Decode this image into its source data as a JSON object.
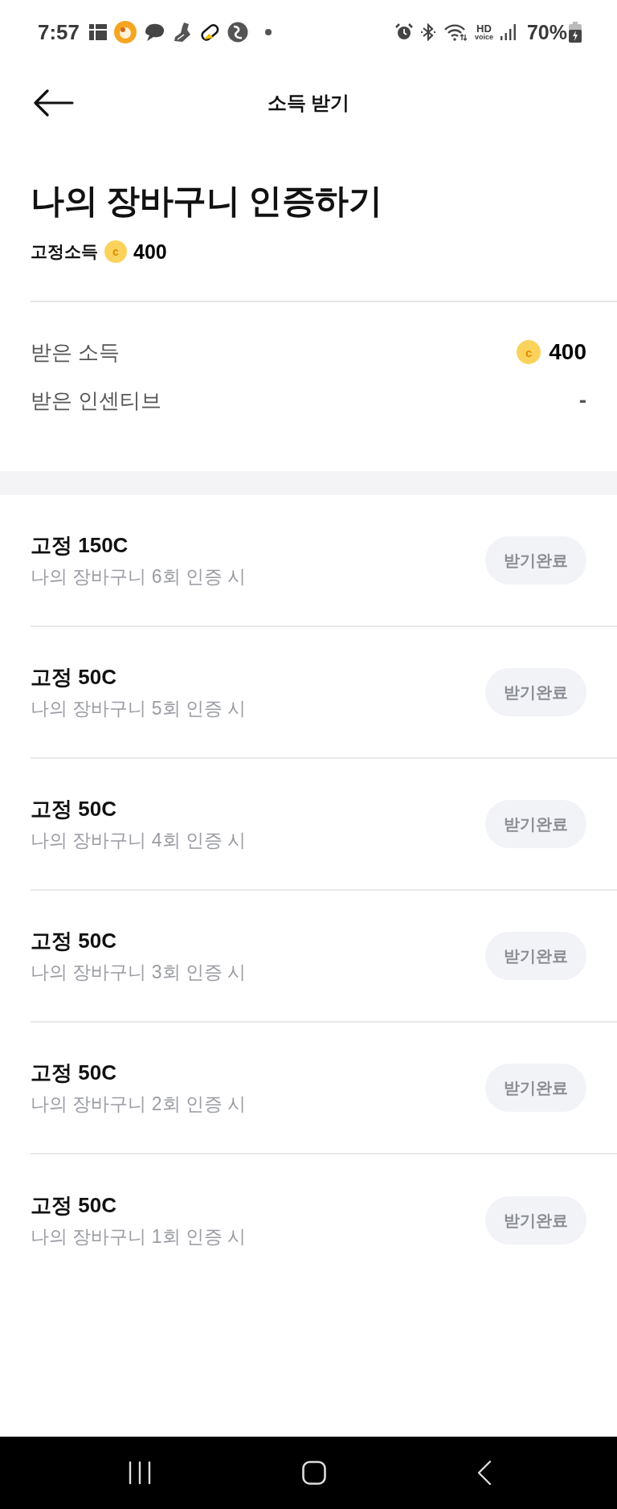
{
  "status_bar": {
    "time": "7:57",
    "hd_top": "HD",
    "hd_bottom": "voice",
    "battery": "70%"
  },
  "header": {
    "title": "소득 받기"
  },
  "mission": {
    "title": "나의 장바구니 인증하기",
    "fixed_label": "고정소득",
    "coin_mark": "c",
    "fixed_amount": "400"
  },
  "summary": [
    {
      "kind": "coin",
      "label": "받은 소득",
      "coin_mark": "c",
      "value": "400"
    },
    {
      "kind": "plain",
      "label": "받은 인센티브",
      "value": "-"
    }
  ],
  "rewards": [
    {
      "title": "고정 150C",
      "condition": "나의 장바구니 6회 인증 시",
      "button": "받기완료",
      "disabled": true
    },
    {
      "title": "고정 50C",
      "condition": "나의 장바구니 5회 인증 시",
      "button": "받기완료",
      "disabled": true
    },
    {
      "title": "고정 50C",
      "condition": "나의 장바구니 4회 인증 시",
      "button": "받기완료",
      "disabled": true
    },
    {
      "title": "고정 50C",
      "condition": "나의 장바구니 3회 인증 시",
      "button": "받기완료",
      "disabled": true
    },
    {
      "title": "고정 50C",
      "condition": "나의 장바구니 2회 인증 시",
      "button": "받기완료",
      "disabled": true
    },
    {
      "title": "고정 50C",
      "condition": "나의 장바구니 1회 인증 시",
      "button": "받기완료",
      "disabled": true
    }
  ]
}
